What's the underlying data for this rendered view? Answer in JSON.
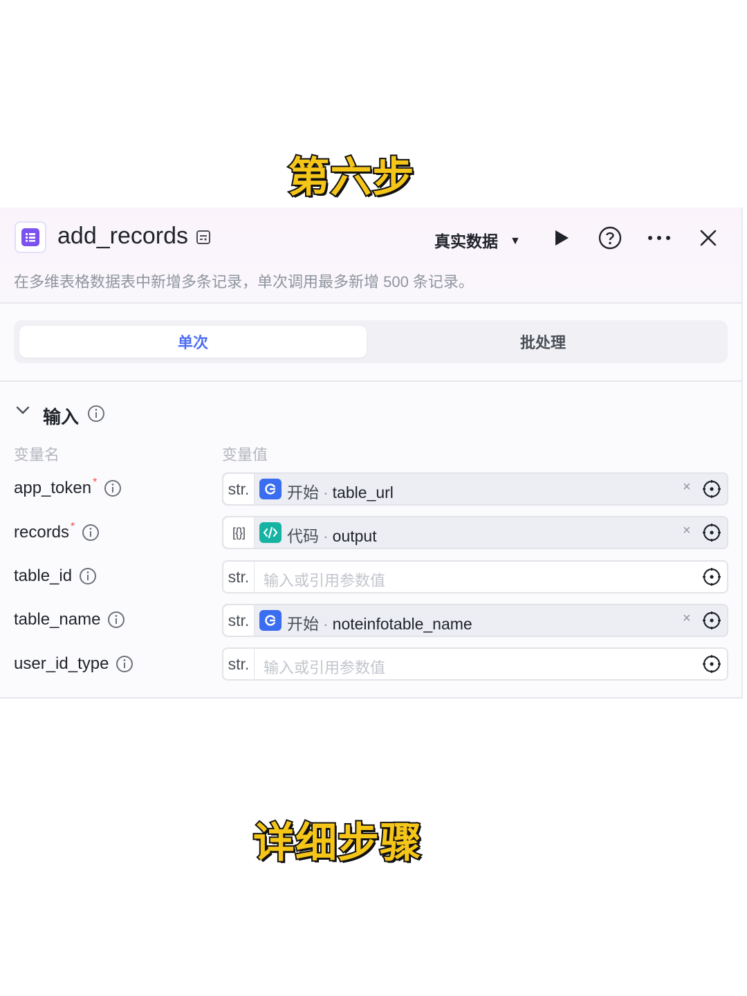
{
  "captions": {
    "top": "第六步",
    "bottom": "详细步骤"
  },
  "header": {
    "title": "add_records",
    "mode_select": "真实数据",
    "description": "在多维表格数据表中新增多条记录，单次调用最多新增 500 条记录。"
  },
  "tabs": [
    {
      "label": "单次",
      "active": true
    },
    {
      "label": "批处理",
      "active": false
    }
  ],
  "input_section": {
    "title": "输入",
    "col_name": "变量名",
    "col_value": "变量值",
    "rows": [
      {
        "name": "app_token",
        "required": true,
        "type": "str.",
        "kind": "ref",
        "source": "开始",
        "var": "table_url"
      },
      {
        "name": "records",
        "required": true,
        "type": "[{}]",
        "kind": "ref",
        "source": "代码",
        "var": "output"
      },
      {
        "name": "table_id",
        "required": false,
        "type": "str.",
        "kind": "input",
        "placeholder": "输入或引用参数值"
      },
      {
        "name": "table_name",
        "required": false,
        "type": "str.",
        "kind": "ref",
        "source": "开始",
        "var": "noteinfotable_name"
      },
      {
        "name": "user_id_type",
        "required": false,
        "type": "str.",
        "kind": "input",
        "placeholder": "输入或引用参数值"
      }
    ]
  },
  "colors": {
    "accent": "#4e6ef2",
    "app_icon": "#7b52f0",
    "start_node": "#3a6df0",
    "code_node": "#16b3a3",
    "required": "#f54a45"
  }
}
